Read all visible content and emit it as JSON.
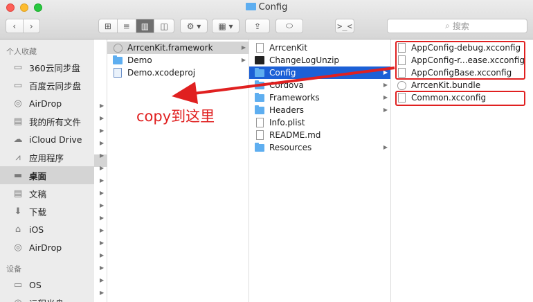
{
  "window": {
    "title": "Config"
  },
  "toolbar": {
    "back_icon": "chevron-left-icon",
    "forward_icon": "chevron-right-icon",
    "view_modes": [
      "icon-view-icon",
      "list-view-icon",
      "column-view-icon",
      "cover-flow-icon"
    ],
    "active_view": "column-view-icon",
    "action_icon": "gear-icon",
    "arrange_icon": "grid-arrange-icon",
    "share_icon": "share-icon",
    "tag_icon": "tag-icon",
    "terminal_label": ">_<",
    "search_placeholder": "搜索"
  },
  "sidebar": {
    "favorites_heading": "个人收藏",
    "favorites": [
      {
        "label": "360云同步盘",
        "icon": "folder-icon"
      },
      {
        "label": "百度云同步盘",
        "icon": "folder-icon"
      },
      {
        "label": "AirDrop",
        "icon": "airdrop-icon"
      },
      {
        "label": "我的所有文件",
        "icon": "all-files-icon"
      },
      {
        "label": "iCloud Drive",
        "icon": "cloud-icon"
      },
      {
        "label": "应用程序",
        "icon": "applications-icon"
      },
      {
        "label": "桌面",
        "icon": "desktop-icon",
        "selected": true
      },
      {
        "label": "文稿",
        "icon": "documents-icon"
      },
      {
        "label": "下载",
        "icon": "download-icon"
      },
      {
        "label": "iOS",
        "icon": "home-icon"
      },
      {
        "label": "AirDrop",
        "icon": "airdrop-icon"
      }
    ],
    "devices_heading": "设备",
    "devices": [
      {
        "label": "OS",
        "icon": "disk-icon"
      },
      {
        "label": "远程光盘",
        "icon": "optical-disk-icon"
      }
    ]
  },
  "columns": [
    {
      "items": [
        {
          "label": "ArrcenKit.framework",
          "icon": "bundle-icon",
          "arrow": true,
          "state": "grey"
        },
        {
          "label": "Demo",
          "icon": "folder-icon",
          "arrow": true
        },
        {
          "label": "Demo.xcodeproj",
          "icon": "xcodeproj-icon",
          "arrow": false
        }
      ]
    },
    {
      "items": [
        {
          "label": "ArrcenKit",
          "icon": "file-icon",
          "arrow": false
        },
        {
          "label": "ChangeLogUnzip",
          "icon": "executable-icon",
          "arrow": false
        },
        {
          "label": "Config",
          "icon": "folder-icon",
          "arrow": true,
          "state": "selected"
        },
        {
          "label": "Cordova",
          "icon": "folder-icon",
          "arrow": true
        },
        {
          "label": "Frameworks",
          "icon": "folder-icon",
          "arrow": true
        },
        {
          "label": "Headers",
          "icon": "folder-icon",
          "arrow": true
        },
        {
          "label": "Info.plist",
          "icon": "file-icon",
          "arrow": false
        },
        {
          "label": "README.md",
          "icon": "file-icon",
          "arrow": false
        },
        {
          "label": "Resources",
          "icon": "folder-icon",
          "arrow": true
        }
      ]
    },
    {
      "items": [
        {
          "label": "AppConfig-debug.xcconfig",
          "icon": "file-icon"
        },
        {
          "label": "AppConfig-r...ease.xcconfig",
          "icon": "file-icon"
        },
        {
          "label": "AppConfigBase.xcconfig",
          "icon": "file-icon"
        },
        {
          "label": "ArrcenKit.bundle",
          "icon": "bundle-icon"
        },
        {
          "label": "Common.xcconfig",
          "icon": "file-icon"
        }
      ]
    }
  ],
  "annotation": {
    "text": "copy到这里",
    "color": "#e01f1f"
  },
  "colors": {
    "selection": "#1c60d6",
    "annotation_red": "#e02020"
  }
}
